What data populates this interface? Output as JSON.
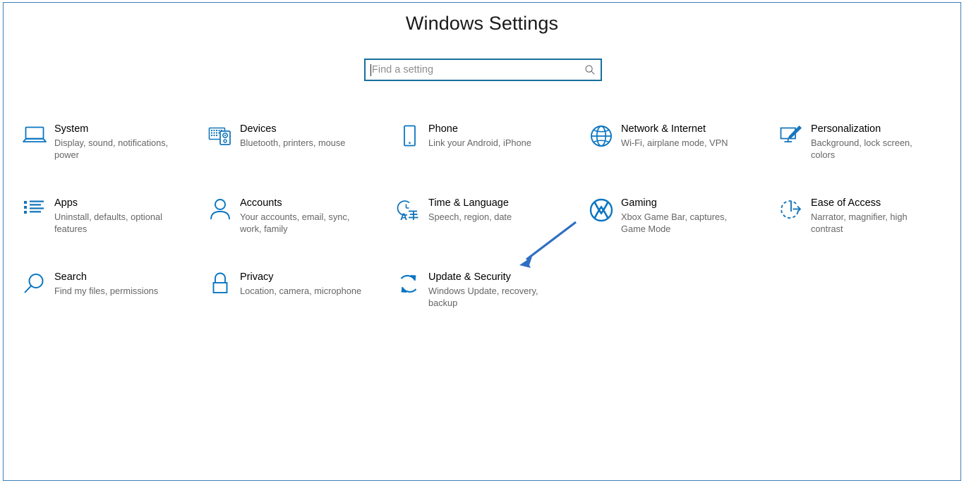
{
  "window": {
    "border_color": "#3f7fb5",
    "background": "#ffffff"
  },
  "header": {
    "title": "Windows Settings"
  },
  "search": {
    "placeholder": "Find a setting",
    "value": "",
    "icon": "search-icon",
    "border_color": "#176f9c"
  },
  "accent_color": "#0078d4",
  "grid": {
    "rows": [
      [
        {
          "icon": "laptop-icon",
          "title": "System",
          "subtitle": "Display, sound, notifications, power"
        },
        {
          "icon": "devices-keyboard-icon",
          "title": "Devices",
          "subtitle": "Bluetooth, printers, mouse"
        },
        {
          "icon": "phone-icon",
          "title": "Phone",
          "subtitle": "Link your Android, iPhone"
        },
        {
          "icon": "globe-icon",
          "title": "Network & Internet",
          "subtitle": "Wi-Fi, airplane mode, VPN"
        },
        {
          "icon": "paintbrush-monitor-icon",
          "title": "Personalization",
          "subtitle": "Background, lock screen, colors"
        }
      ],
      [
        {
          "icon": "app-list-icon",
          "title": "Apps",
          "subtitle": "Uninstall, defaults, optional features"
        },
        {
          "icon": "person-icon",
          "title": "Accounts",
          "subtitle": "Your accounts, email, sync, work, family"
        },
        {
          "icon": "clock-language-icon",
          "title": "Time & Language",
          "subtitle": "Speech, region, date"
        },
        {
          "icon": "xbox-icon",
          "title": "Gaming",
          "subtitle": "Xbox Game Bar, captures, Game Mode"
        },
        {
          "icon": "ease-of-access-icon",
          "title": "Ease of Access",
          "subtitle": "Narrator, magnifier, high contrast"
        }
      ],
      [
        {
          "icon": "magnifier-icon",
          "title": "Search",
          "subtitle": "Find my files, permissions"
        },
        {
          "icon": "lock-icon",
          "title": "Privacy",
          "subtitle": "Location, camera, microphone"
        },
        {
          "icon": "sync-refresh-icon",
          "title": "Update & Security",
          "subtitle": "Windows Update, recovery, backup"
        }
      ]
    ]
  },
  "annotation": {
    "type": "arrow",
    "color": "#2f6fc0",
    "points_to": "Update & Security"
  }
}
